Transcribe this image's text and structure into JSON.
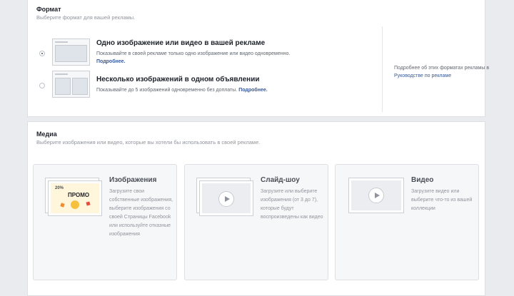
{
  "format": {
    "title": "Формат",
    "subtitle": "Выберите формат для вашей рекламы.",
    "options": [
      {
        "title": "Одно изображение или видео в вашей рекламе",
        "description": "Показывайте в своей рекламе только одно изображение или видео одновременно.",
        "link": "Подробнее.",
        "selected": true
      },
      {
        "title": "Несколько изображений в одном объявлении",
        "description": "Показывайте до 5 изображений одновременно без доплаты.",
        "link": "Подробнее.",
        "selected": false
      }
    ],
    "side_note": "Подробнее об этих форматах рекламы в",
    "side_note_link": "Руководстве по рекламе"
  },
  "media": {
    "title": "Медиа",
    "subtitle": "Выберите изображения или видео, которые вы хотели бы использовать в своей рекламе.",
    "cards": [
      {
        "title": "Изображения",
        "description": "Загрузите свои собственные изображения, выберите изображения со своей Страницы Facebook или используйте отказные изображения",
        "icon": "image-stack-icon",
        "promo_text": "ПРОМО"
      },
      {
        "title": "Слайд-шоу",
        "description": "Загрузите или выберите изображения (от 3 до 7), которые будут воспроизведены как видео",
        "icon": "slideshow-play-icon"
      },
      {
        "title": "Видео",
        "description": "Загрузите видео или выберите что-то из вашей коллекции",
        "icon": "video-play-icon"
      }
    ]
  },
  "colors": {
    "background": "#e9ebee",
    "link": "#365899",
    "promo_yellow": "#f6c23e"
  }
}
